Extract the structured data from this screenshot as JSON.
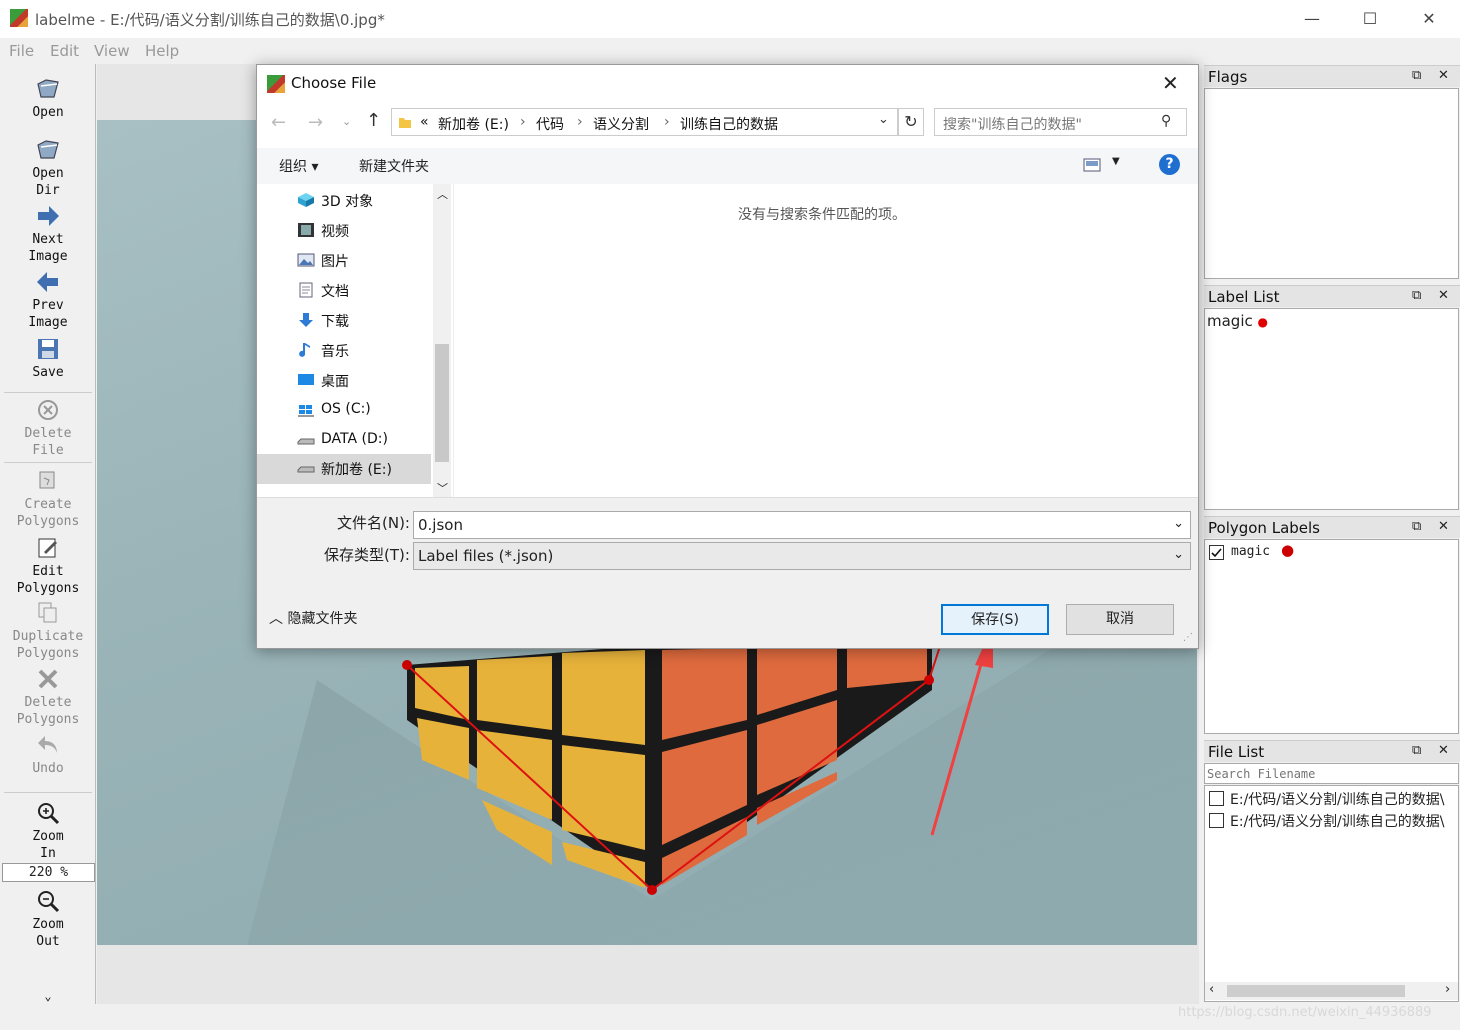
{
  "window": {
    "title": "labelme - E:/代码/语义分割/训练自己的数据\\0.jpg*",
    "minimize": "—",
    "maximize": "☐",
    "close": "✕"
  },
  "menu": [
    "File",
    "Edit",
    "View",
    "Help"
  ],
  "toolbar": {
    "open": "Open",
    "open_dir": "Open\nDir",
    "next_image": "Next\nImage",
    "prev_image": "Prev\nImage",
    "save": "Save",
    "delete_file": "Delete\nFile",
    "create_polygons": "Create\nPolygons",
    "edit_polygons": "Edit\nPolygons",
    "duplicate_polygons": "Duplicate\nPolygons",
    "delete_polygons": "Delete\nPolygons",
    "undo": "Undo",
    "zoom_in": "Zoom\nIn",
    "zoom_value": "220 %",
    "zoom_out": "Zoom\nOut",
    "more": "⌄"
  },
  "panels": {
    "flags": {
      "title": "Flags"
    },
    "label_list": {
      "title": "Label List",
      "items": [
        {
          "label": "magic",
          "color": "#e00000"
        }
      ]
    },
    "polygon_labels": {
      "title": "Polygon Labels",
      "items": [
        {
          "label": "magic",
          "checked": true,
          "color": "#cc0000"
        }
      ]
    },
    "file_list": {
      "title": "File List",
      "search_placeholder": "Search Filename",
      "items": [
        "E:/代码/语义分割/训练自己的数据\\",
        "E:/代码/语义分割/训练自己的数据\\"
      ]
    }
  },
  "dialog": {
    "title": "Choose File",
    "breadcrumb": [
      "«",
      "新加卷 (E:)",
      "代码",
      "语义分割",
      "训练自己的数据"
    ],
    "search_placeholder": "搜索\"训练自己的数据\"",
    "organize": "组织 ▾",
    "new_folder": "新建文件夹",
    "nav_items": [
      "3D 对象",
      "视频",
      "图片",
      "文档",
      "下载",
      "音乐",
      "桌面",
      "OS (C:)",
      "DATA (D:)",
      "新加卷 (E:)"
    ],
    "empty_message": "没有与搜索条件匹配的项。",
    "filename_label": "文件名(N):",
    "filename_value": "0.json",
    "filetype_label": "保存类型(T):",
    "filetype_value": "Label files (*.json)",
    "hide_folders": "隐藏文件夹",
    "save_button": "保存(S)",
    "cancel_button": "取消"
  },
  "watermark": "https://blog.csdn.net/weixin_44936889",
  "colors": {
    "polygon": "#dd1111",
    "accent": "#0078d7"
  }
}
